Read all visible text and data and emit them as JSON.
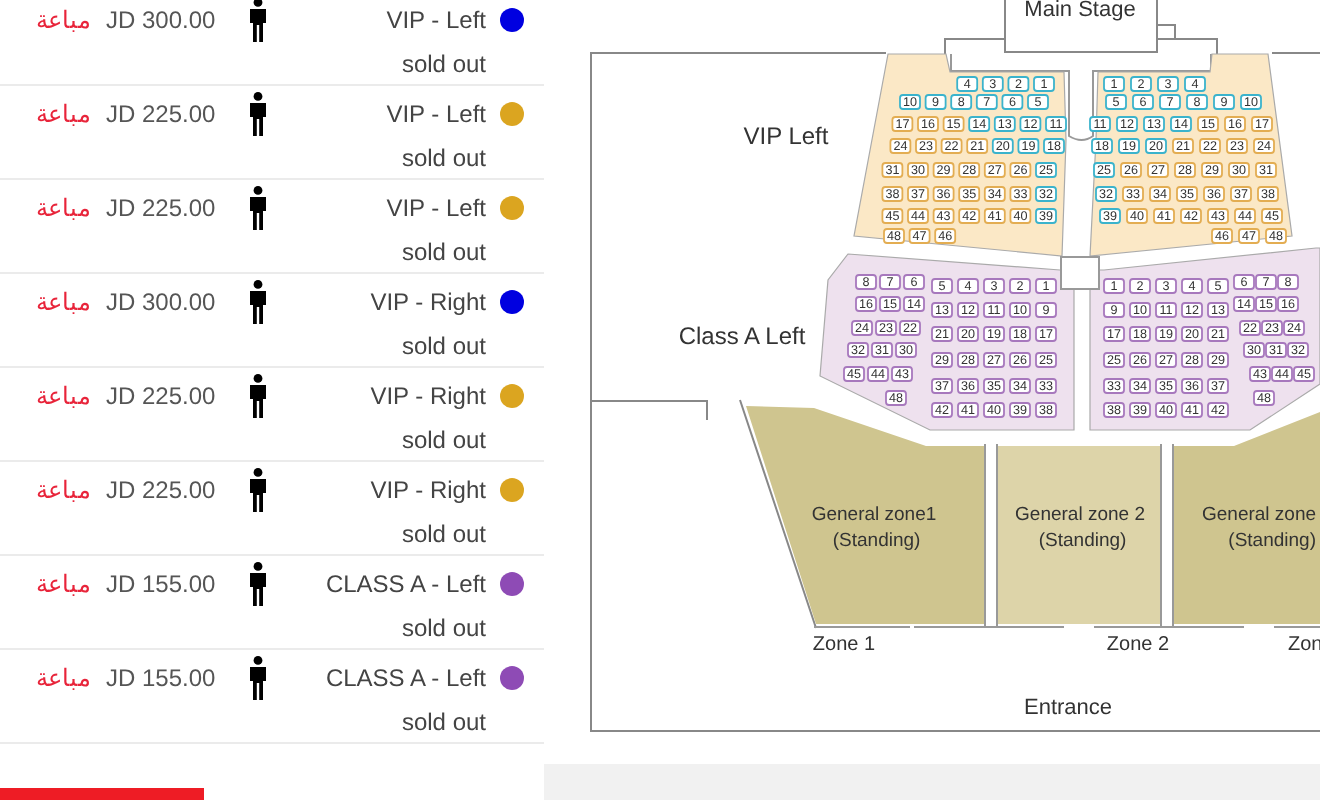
{
  "tickets": [
    {
      "status": "مباعة",
      "price": "JD 300.00",
      "section": "VIP - Left",
      "availability": "sold out",
      "color": "#0000e0"
    },
    {
      "status": "مباعة",
      "price": "JD 225.00",
      "section": "VIP - Left",
      "availability": "sold out",
      "color": "#dba520"
    },
    {
      "status": "مباعة",
      "price": "JD 225.00",
      "section": "VIP - Left",
      "availability": "sold out",
      "color": "#dba520"
    },
    {
      "status": "مباعة",
      "price": "JD 300.00",
      "section": "VIP - Right",
      "availability": "sold out",
      "color": "#0000e0"
    },
    {
      "status": "مباعة",
      "price": "JD 225.00",
      "section": "VIP - Right",
      "availability": "sold out",
      "color": "#dba520"
    },
    {
      "status": "مباعة",
      "price": "JD 225.00",
      "section": "VIP - Right",
      "availability": "sold out",
      "color": "#dba520"
    },
    {
      "status": "مباعة",
      "price": "JD 155.00",
      "section": "CLASS A - Left",
      "availability": "sold out",
      "color": "#8e4bb5"
    },
    {
      "status": "مباعة",
      "price": "JD 155.00",
      "section": "CLASS A - Left",
      "availability": "sold out",
      "color": "#8e4bb5"
    }
  ],
  "map": {
    "stage": "Main Stage",
    "labels": [
      "VIP Left",
      "Class A Left"
    ],
    "sections": [
      {
        "rows": [
          [
            {
              "color": "#3bb3cc",
              "seats": [
                "4",
                "3",
                "2",
                "1"
              ]
            }
          ],
          [
            {
              "color": "#3bb3cc",
              "seats": [
                "10",
                "9",
                "8",
                "7",
                "6",
                "5"
              ]
            }
          ],
          [
            {
              "color": "#e3ad52",
              "seats": [
                "17",
                "16",
                "15"
              ]
            },
            {
              "color": "#3bb3cc",
              "seats": [
                "14",
                "13",
                "12",
                "11"
              ]
            }
          ],
          [
            {
              "color": "#e3ad52",
              "seats": [
                "24",
                "23",
                "22",
                "21"
              ]
            },
            {
              "color": "#3bb3cc",
              "seats": [
                "20",
                "19",
                "18"
              ]
            }
          ],
          [
            {
              "color": "#e3ad52",
              "seats": [
                "31",
                "30",
                "29",
                "28",
                "27",
                "26"
              ]
            },
            {
              "color": "#3bb3cc",
              "seats": [
                "25"
              ]
            }
          ],
          [
            {
              "color": "#e3ad52",
              "seats": [
                "38",
                "37",
                "36",
                "35",
                "34",
                "33"
              ]
            },
            {
              "color": "#3bb3cc",
              "seats": [
                "32"
              ]
            }
          ],
          [
            {
              "color": "#e3ad52",
              "seats": [
                "45",
                "44",
                "43",
                "42",
                "41",
                "40"
              ]
            },
            {
              "color": "#3bb3cc",
              "seats": [
                "39"
              ]
            }
          ],
          [
            {
              "color": "#e3ad52",
              "seats": [
                "48",
                "47",
                "46"
              ]
            }
          ]
        ]
      },
      {
        "rows": [
          [
            {
              "color": "#3bb3cc",
              "seats": [
                "1",
                "2",
                "3",
                "4"
              ]
            }
          ],
          [
            {
              "color": "#3bb3cc",
              "seats": [
                "5",
                "6",
                "7",
                "8",
                "9",
                "10"
              ]
            }
          ],
          [
            {
              "color": "#3bb3cc",
              "seats": [
                "11",
                "12",
                "13",
                "14"
              ]
            },
            {
              "color": "#e3ad52",
              "seats": [
                "15",
                "16",
                "17"
              ]
            }
          ],
          [
            {
              "color": "#3bb3cc",
              "seats": [
                "18",
                "19",
                "20"
              ]
            },
            {
              "color": "#e3ad52",
              "seats": [
                "21",
                "22",
                "23",
                "24"
              ]
            }
          ],
          [
            {
              "color": "#3bb3cc",
              "seats": [
                "25"
              ]
            },
            {
              "color": "#e3ad52",
              "seats": [
                "26",
                "27",
                "28",
                "29",
                "30",
                "31"
              ]
            }
          ],
          [
            {
              "color": "#3bb3cc",
              "seats": [
                "32"
              ]
            },
            {
              "color": "#e3ad52",
              "seats": [
                "33",
                "34",
                "35",
                "36",
                "37",
                "38"
              ]
            }
          ],
          [
            {
              "color": "#3bb3cc",
              "seats": [
                "39"
              ]
            },
            {
              "color": "#e3ad52",
              "seats": [
                "40",
                "41",
                "42",
                "43",
                "44",
                "45"
              ]
            }
          ],
          [
            {
              "color": "#e3ad52",
              "seats": [
                "46",
                "47",
                "48"
              ]
            }
          ]
        ]
      },
      {
        "rows": [
          [
            {
              "color": "#a778bd",
              "seats": [
                "8",
                "7",
                "6"
              ]
            }
          ],
          [
            {
              "color": "#a778bd",
              "seats": [
                "16",
                "15",
                "14"
              ]
            }
          ],
          [
            {
              "color": "#a778bd",
              "seats": [
                "24",
                "23",
                "22"
              ]
            }
          ],
          [
            {
              "color": "#a778bd",
              "seats": [
                "32",
                "31",
                "30"
              ]
            }
          ],
          [
            {
              "color": "#a778bd",
              "seats": [
                "45",
                "44",
                "43"
              ]
            }
          ],
          [
            {
              "color": "#a778bd",
              "seats": [
                "48"
              ]
            }
          ]
        ]
      },
      {
        "rows": [
          [
            {
              "color": "#a778bd",
              "seats": [
                "5",
                "4",
                "3",
                "2",
                "1"
              ]
            }
          ],
          [
            {
              "color": "#a778bd",
              "seats": [
                "13",
                "12",
                "11",
                "10",
                "9"
              ]
            }
          ],
          [
            {
              "color": "#a778bd",
              "seats": [
                "21",
                "20",
                "19",
                "18",
                "17"
              ]
            }
          ],
          [
            {
              "color": "#a778bd",
              "seats": [
                "29",
                "28",
                "27",
                "26",
                "25"
              ]
            }
          ],
          [
            {
              "color": "#a778bd",
              "seats": [
                "37",
                "36",
                "35",
                "34",
                "33"
              ]
            }
          ],
          [
            {
              "color": "#a778bd",
              "seats": [
                "42",
                "41",
                "40",
                "39",
                "38"
              ]
            }
          ]
        ]
      },
      {
        "rows": [
          [
            {
              "color": "#a778bd",
              "seats": [
                "1",
                "2",
                "3",
                "4",
                "5"
              ]
            }
          ],
          [
            {
              "color": "#a778bd",
              "seats": [
                "9",
                "10",
                "11",
                "12",
                "13"
              ]
            }
          ],
          [
            {
              "color": "#a778bd",
              "seats": [
                "17",
                "18",
                "19",
                "20",
                "21"
              ]
            }
          ],
          [
            {
              "color": "#a778bd",
              "seats": [
                "25",
                "26",
                "27",
                "28",
                "29"
              ]
            }
          ],
          [
            {
              "color": "#a778bd",
              "seats": [
                "33",
                "34",
                "35",
                "36",
                "37"
              ]
            }
          ],
          [
            {
              "color": "#a778bd",
              "seats": [
                "38",
                "39",
                "40",
                "41",
                "42"
              ]
            }
          ]
        ]
      },
      {
        "rows": [
          [
            {
              "color": "#a778bd",
              "seats": [
                "6",
                "7",
                "8"
              ]
            }
          ],
          [
            {
              "color": "#a778bd",
              "seats": [
                "14",
                "15",
                "16"
              ]
            }
          ],
          [
            {
              "color": "#a778bd",
              "seats": [
                "22",
                "23",
                "24"
              ]
            }
          ],
          [
            {
              "color": "#a778bd",
              "seats": [
                "30",
                "31",
                "32"
              ]
            }
          ],
          [
            {
              "color": "#a778bd",
              "seats": [
                "43",
                "44",
                "45"
              ]
            }
          ],
          [
            {
              "color": "#a778bd",
              "seats": [
                "48"
              ]
            }
          ]
        ]
      }
    ],
    "zones": [
      {
        "name": "General zone1",
        "note": "(Standing)"
      },
      {
        "name": "General zone 2",
        "note": "(Standing)"
      },
      {
        "name": "General zone",
        "note": "(Standing)"
      }
    ],
    "gates": [
      "Zone 1",
      "Zone 2",
      "Zon"
    ],
    "entrance": "Entrance"
  }
}
